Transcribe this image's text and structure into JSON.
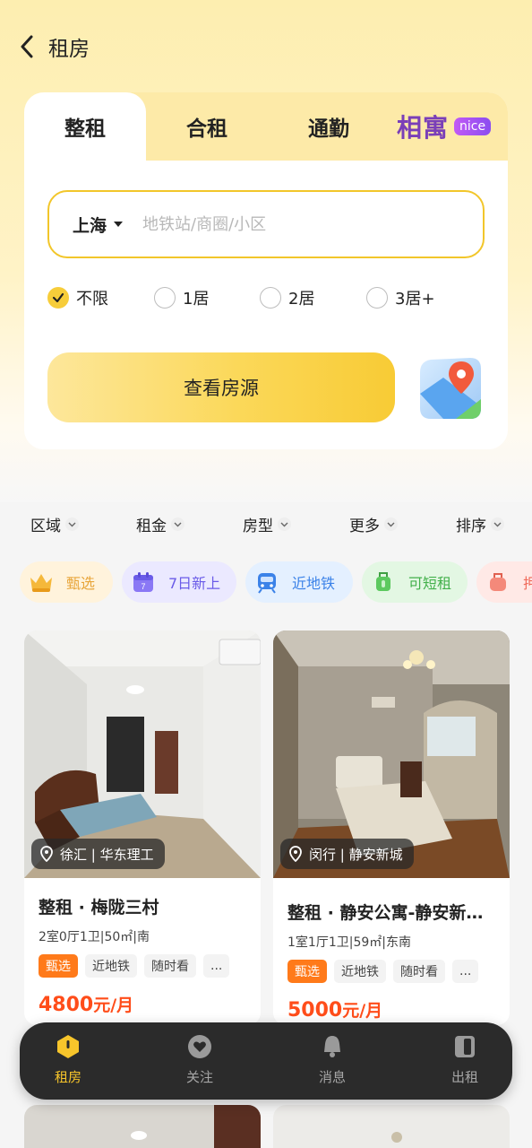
{
  "header": {
    "title": "租房"
  },
  "search_card": {
    "tabs": [
      {
        "label": "整租",
        "active": true
      },
      {
        "label": "合租",
        "active": false
      },
      {
        "label": "通勤",
        "active": false
      }
    ],
    "brand": {
      "name": "相寓",
      "badge": "nice"
    },
    "city": "上海",
    "search_placeholder": "地铁站/商圈/小区",
    "room_options": [
      {
        "label": "不限",
        "checked": true
      },
      {
        "label": "1居",
        "checked": false
      },
      {
        "label": "2居",
        "checked": false
      },
      {
        "label": "3居+",
        "checked": false
      }
    ],
    "cta_label": "查看房源"
  },
  "filters": [
    "区域",
    "租金",
    "房型",
    "更多",
    "排序"
  ],
  "quick_tags": [
    {
      "label": "甄选",
      "icon": "crown-icon",
      "color": "#e8a53a",
      "bg": "#fff3dc"
    },
    {
      "label": "7日新上",
      "icon": "calendar-icon",
      "color": "#6a5be8",
      "bg": "#ebe9ff"
    },
    {
      "label": "近地铁",
      "icon": "subway-icon",
      "color": "#3b82e8",
      "bg": "#e4f0ff"
    },
    {
      "label": "可短租",
      "icon": "luggage-icon",
      "color": "#43b04b",
      "bg": "#e3f7e3"
    },
    {
      "label": "押",
      "icon": "bag-icon",
      "color": "#f06a5a",
      "bg": "#ffe9e6"
    }
  ],
  "listings": [
    {
      "location": "徐汇 | 华东理工",
      "title": "整租 · 梅陇三村",
      "meta": "2室0厅1卫|50㎡|南",
      "tags": [
        "甄选",
        "近地铁",
        "随时看",
        "..."
      ],
      "price_value": "4800",
      "price_unit": "元/月"
    },
    {
      "location": "闵行 | 静安新城",
      "title": "整租 · 静安公寓-静安新…",
      "meta": "1室1厅1卫|59㎡|东南",
      "tags": [
        "甄选",
        "近地铁",
        "随时看",
        "..."
      ],
      "price_value": "5000",
      "price_unit": "元/月"
    }
  ],
  "tabbar": [
    {
      "label": "租房",
      "icon": "home-icon",
      "active": true
    },
    {
      "label": "关注",
      "icon": "heart-icon",
      "active": false
    },
    {
      "label": "消息",
      "icon": "bell-icon",
      "active": false
    },
    {
      "label": "出租",
      "icon": "door-icon",
      "active": false
    }
  ],
  "colors": {
    "accent": "#f7c52b",
    "price": "#ff4d1a",
    "brand": "#7a3fb8"
  }
}
